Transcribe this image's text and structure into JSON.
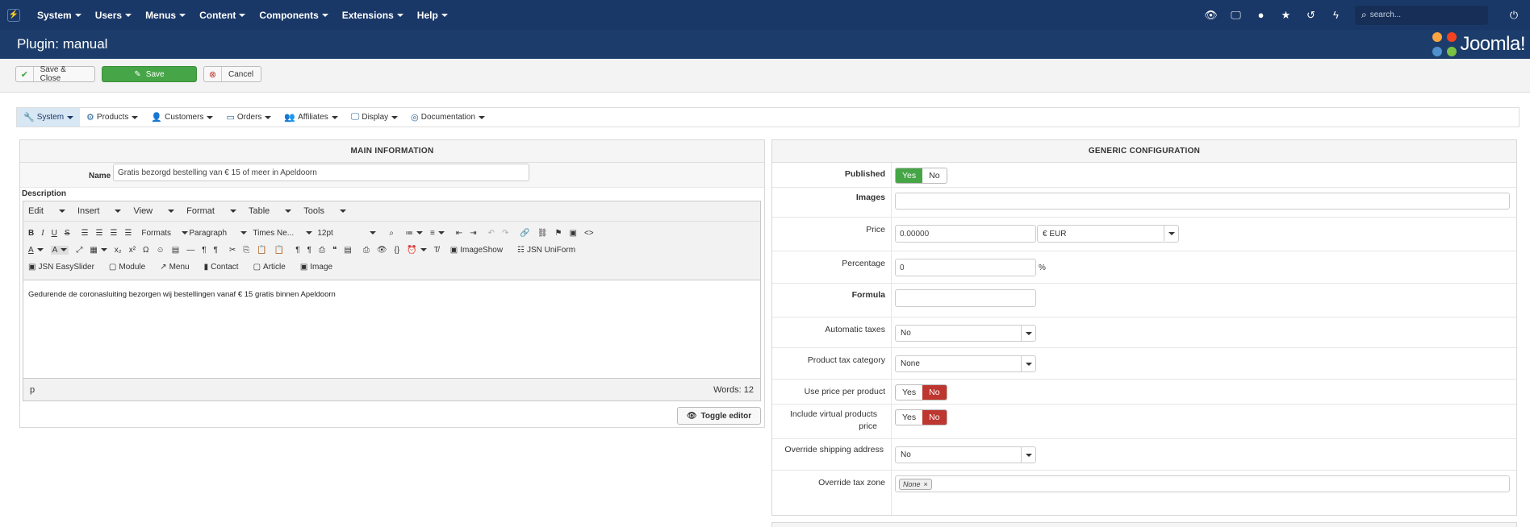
{
  "topnav": {
    "menu": [
      "System",
      "Users",
      "Menus",
      "Content",
      "Components",
      "Extensions",
      "Help"
    ],
    "search_placeholder": "search..."
  },
  "page": {
    "title": "Plugin: manual",
    "brand": "Joomla!"
  },
  "toolbar": {
    "save_close": "Save & Close",
    "save": "Save",
    "cancel": "Cancel"
  },
  "tabs": [
    "System",
    "Products",
    "Customers",
    "Orders",
    "Affiliates",
    "Display",
    "Documentation"
  ],
  "main_info": {
    "header": "MAIN INFORMATION",
    "name_label": "Name",
    "name_value": "Gratis bezorgd bestelling van € 15 of meer in Apeldoorn",
    "description_label": "Description",
    "editor_menu": [
      "Edit",
      "Insert",
      "View",
      "Format",
      "Table",
      "Tools"
    ],
    "formats_label": "Formats",
    "block_label": "Paragraph",
    "font_label": "Times Ne...",
    "size_label": "12pt",
    "plugin_buttons": [
      "ImageShow",
      "JSN UniForm",
      "JSN EasySlider",
      "Module",
      "Menu",
      "Contact",
      "Article",
      "Image"
    ],
    "content": "Gedurende de coronasluiting bezorgen wij bestellingen vanaf € 15 gratis binnen Apeldoorn",
    "path": "p",
    "words": "Words: 12",
    "toggle_editor": "Toggle editor"
  },
  "generic": {
    "header": "GENERIC CONFIGURATION",
    "published_label": "Published",
    "images_label": "Images",
    "price_label": "Price",
    "price_value": "0.00000",
    "currency": "€ EUR",
    "percentage_label": "Percentage",
    "percentage_value": "0",
    "percent_sign": "%",
    "formula_label": "Formula",
    "auto_taxes_label": "Automatic taxes",
    "auto_taxes_value": "No",
    "tax_cat_label": "Product tax category",
    "tax_cat_value": "None",
    "price_per_product_label": "Use price per product",
    "virtual_label": "Include virtual products price",
    "override_ship_label": "Override shipping address",
    "override_ship_value": "No",
    "override_tax_label": "Override tax zone",
    "override_tax_chip": "None",
    "yes": "Yes",
    "no": "No"
  },
  "colors": {
    "topbar": "#1a3867",
    "green": "#46a546",
    "red": "#bd362f"
  }
}
